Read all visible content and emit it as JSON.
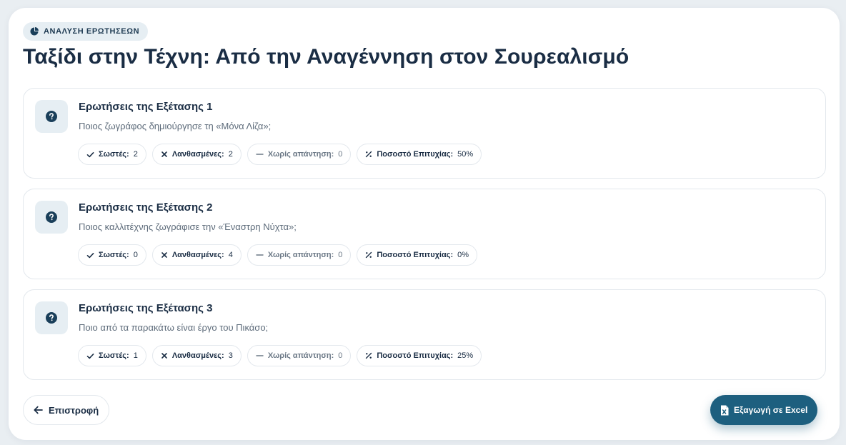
{
  "header": {
    "badge_label": "ΑΝΑΛΥΣΗ ΕΡΩΤΗΣΕΩΝ",
    "title": "Ταξίδι στην Τέχνη: Από την Αναγέννηση στον Σουρεαλισμό"
  },
  "stat_labels": {
    "correct": "Σωστές:",
    "wrong": "Λανθασμένες:",
    "unanswered": "Χωρίς απάντηση:",
    "success_rate": "Ποσοστό Επιτυχίας:"
  },
  "questions": [
    {
      "title": "Ερωτήσεις της Εξέτασης 1",
      "text": "Ποιος ζωγράφος δημιούργησε τη «Μόνα Λίζα»;",
      "correct": "2",
      "wrong": "2",
      "unanswered": "0",
      "success_rate": "50%"
    },
    {
      "title": "Ερωτήσεις της Εξέτασης 2",
      "text": "Ποιος καλλιτέχνης ζωγράφισε την «Έναστρη Νύχτα»;",
      "correct": "0",
      "wrong": "4",
      "unanswered": "0",
      "success_rate": "0%"
    },
    {
      "title": "Ερωτήσεις της Εξέτασης 3",
      "text": "Ποιο από τα παρακάτω είναι έργο του Πικάσο;",
      "correct": "1",
      "wrong": "3",
      "unanswered": "0",
      "success_rate": "25%"
    }
  ],
  "footer": {
    "back_label": "Επιστροφή",
    "export_label": "Εξαγωγή σε Excel"
  },
  "colors": {
    "accent": "#1d5f7f",
    "title": "#1a2d44",
    "icon_bg": "#e6eef3"
  },
  "icons": {
    "badge": "pie-chart-icon",
    "question": "question-circle-icon",
    "correct": "check-icon",
    "wrong": "x-icon",
    "unanswered": "dash-icon",
    "success_rate": "percent-icon",
    "back": "arrow-left-icon",
    "export": "excel-file-icon"
  }
}
